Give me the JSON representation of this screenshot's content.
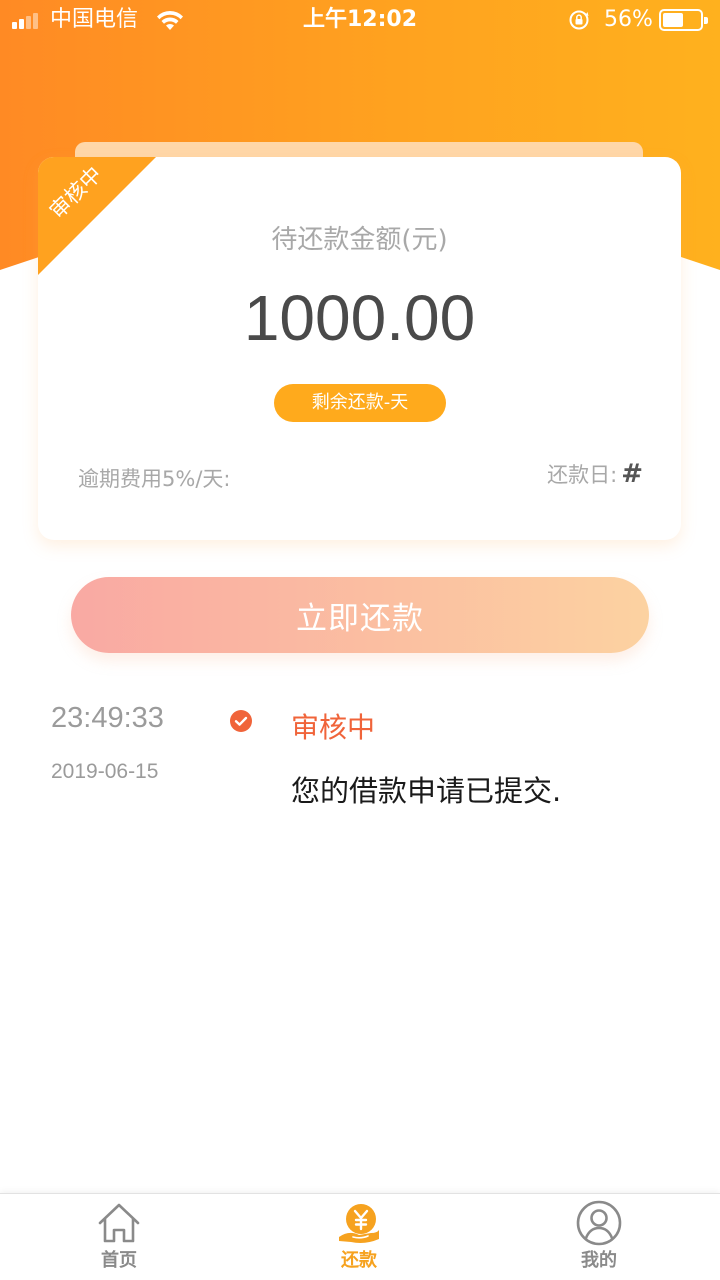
{
  "status_bar": {
    "carrier": "中国电信",
    "time": "上午12:02",
    "battery_percent": "56%",
    "battery_level": 0.56
  },
  "card": {
    "ribbon": "审核中",
    "amount_label": "待还款金额(元)",
    "amount": "1000.00",
    "remaining": "剩余还款-天",
    "overdue_fee": "逾期费用5%/天:",
    "due_label": "还款日:",
    "due_value": "#"
  },
  "repay_button": "立即还款",
  "timeline": [
    {
      "time": "23:49:33",
      "date": "2019-06-15",
      "status": "审核中",
      "message": "您的借款申请已提交."
    }
  ],
  "tabs": [
    {
      "label": "首页",
      "icon": "home-icon",
      "active": false
    },
    {
      "label": "还款",
      "icon": "yuan-hand-icon",
      "active": true
    },
    {
      "label": "我的",
      "icon": "user-icon",
      "active": false
    }
  ],
  "colors": {
    "accent": "#ffa21f",
    "status_text": "#f0643a",
    "inactive_tab": "#8a8a8a"
  }
}
